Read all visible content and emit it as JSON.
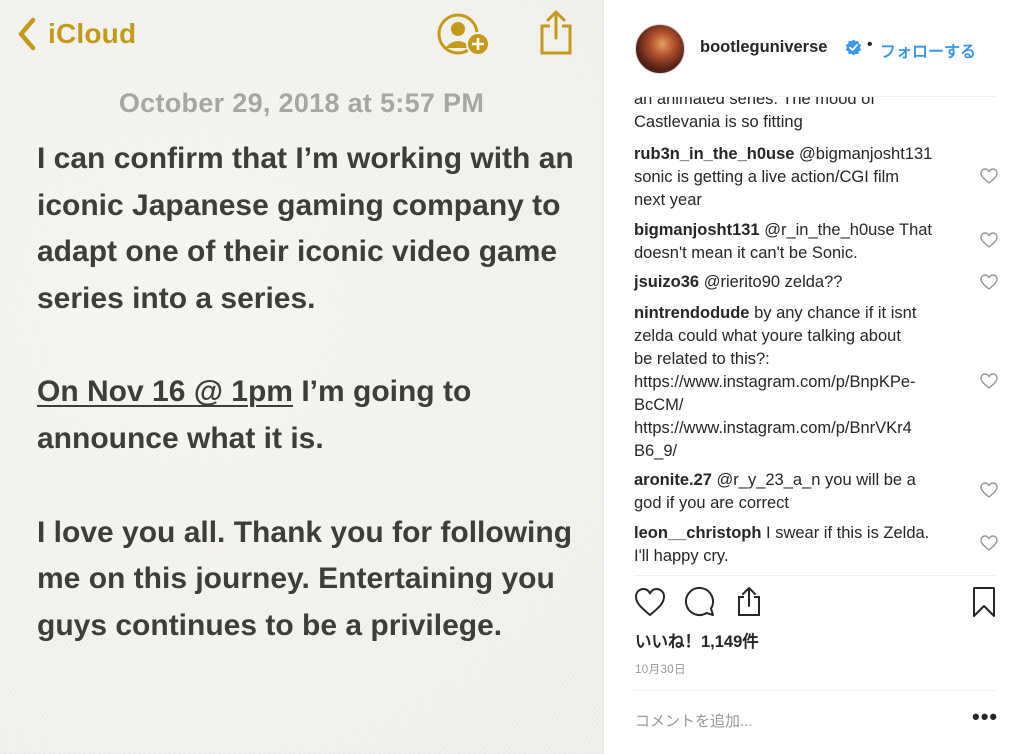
{
  "notes": {
    "back_label": "iCloud",
    "date": "October 29, 2018 at 5:57 PM",
    "paragraph1": "I can confirm that I’m working with an iconic Japanese gaming company to adapt one of their iconic video game series into a series.",
    "paragraph2_underlined": "On Nov 16 @ 1pm",
    "paragraph2_rest": " I’m going to announce what it is.",
    "paragraph3": "I love you all. Thank you for following me on this journey. Entertaining you guys continues to be a privilege.",
    "accent_color": "#c49a1b",
    "icons": {
      "back": "chevron-left-icon",
      "add_person": "add-person-icon",
      "share": "share-icon"
    }
  },
  "instagram": {
    "username": "bootleguniverse",
    "separator": "•",
    "follow_label": "フォローする",
    "comments": [
      {
        "user": "",
        "text": "an animated series. The mood of\nCastlevania is so fitting"
      },
      {
        "user": "rub3n_in_the_h0use",
        "text": " @bigmanjosht131\nsonic is getting a live action/CGI film\nnext year"
      },
      {
        "user": "bigmanjosht131",
        "text": " @r_in_the_h0use That\ndoesn't mean it can't be Sonic."
      },
      {
        "user": "jsuizo36",
        "text": " @rierito90 zelda??"
      },
      {
        "user": "nintrendodude",
        "text": " by any chance if it isnt\nzelda could what youre talking about\nbe related to this?:\nhttps://www.instagram.com/p/BnpKPe-\nBcCM/\nhttps://www.instagram.com/p/BnrVKr4\nB6_9/"
      },
      {
        "user": "aronite.27",
        "text": " @r_y_23_a_n you will be a\ngod if you are correct"
      },
      {
        "user": "leon__christoph",
        "text": " I swear if this is Zelda.\nI'll happy cry."
      }
    ],
    "likes_label": "いいね！1,149件",
    "post_date": "10月30日",
    "add_comment_placeholder": "コメントを追加...",
    "more_label": "•••",
    "accent_color": "#3897f0",
    "icons": {
      "verified": "verified-badge-icon",
      "like": "heart-icon",
      "comment": "comment-icon",
      "share": "share-icon",
      "save": "bookmark-icon",
      "more": "more-options-icon"
    }
  }
}
